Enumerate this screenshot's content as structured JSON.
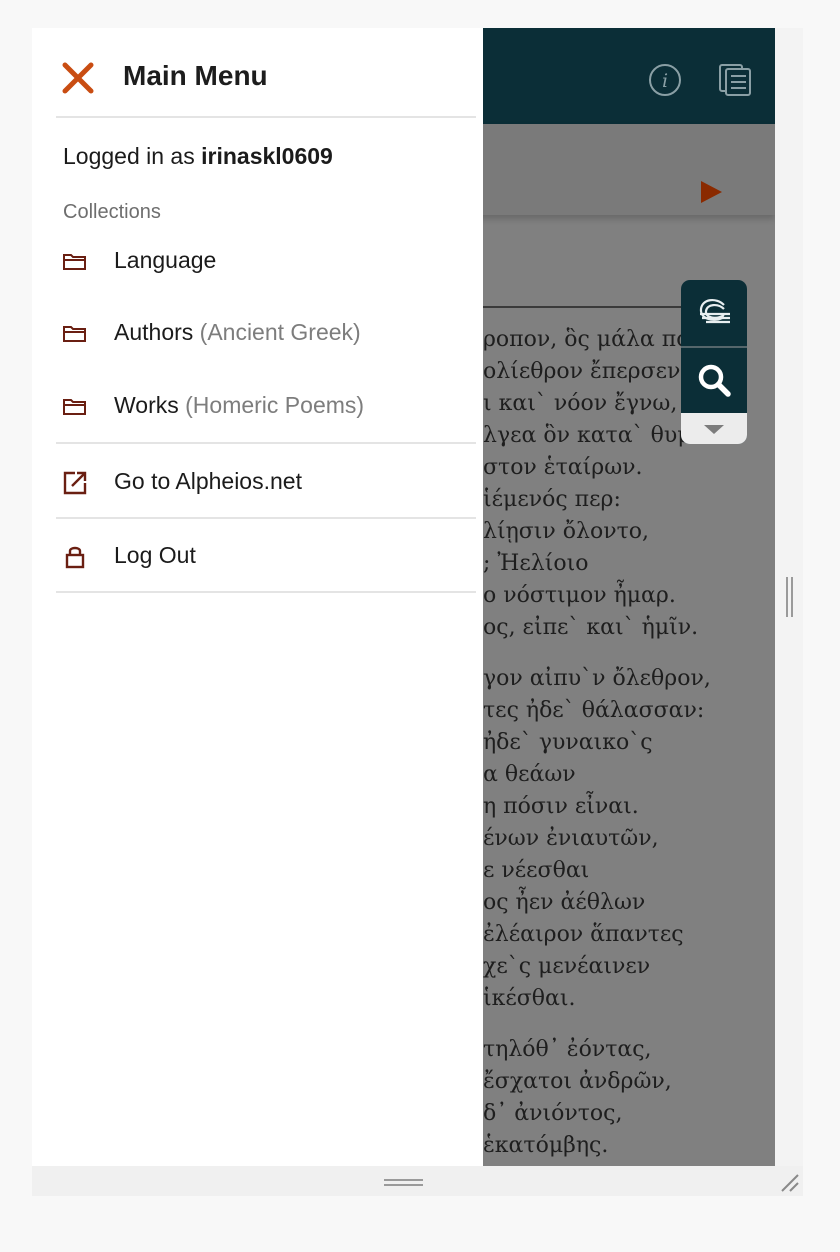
{
  "menu": {
    "title": "Main Menu",
    "login_prefix": "Logged in as",
    "username": "irinaskl0609",
    "collections_label": "Collections",
    "items": [
      {
        "label": "Language",
        "sub": ""
      },
      {
        "label": "Authors",
        "sub": "(Ancient Greek)"
      },
      {
        "label": "Works",
        "sub": "(Homeric Poems)"
      }
    ],
    "goto_label": "Go to Alpheios.net",
    "logout_label": "Log Out"
  },
  "reader": {
    "stanza1": [
      "ροπον, ὃς μάλα πολ",
      "ολίεθρον ἔπερσεν:",
      "ι και` νόον ἔγνω,",
      "λγεα ὃν κατα` θυμ",
      "στον ἑταίρων.",
      "ἱέμενός περ:",
      "λίῃσιν ὄλοντο,",
      "; Ἠελίοιο",
      "ο νόστιμον ἦμαρ.",
      "ος, εἰπε` και` ἡμῖν."
    ],
    "stanza2": [
      "γον αἰπυ`ν ὄλεθρον,",
      "τες ἠδε` θάλασσαν:",
      "ἠδε` γυναικο`ς",
      "α θεάων",
      "η πόσιν εἶναι.",
      "ένων ἐνιαυτῶν,",
      "ε νέεσθαι",
      "ος ἦεν ἀέθλων",
      "ἐλέαιρον ἅπαντες",
      "χε`ς μενέαινεν",
      "ἱκέσθαι."
    ],
    "stanza3": [
      "τηλόθ᾽ ἐόντας,",
      "ἔσχατοι ἀνδρῶν,",
      "δ᾽ ἀνιόντος,",
      "ἑκατόμβης."
    ]
  },
  "colors": {
    "accent": "#c94d12",
    "header": "#0b2e37",
    "icon_brown": "#6a1f12"
  }
}
